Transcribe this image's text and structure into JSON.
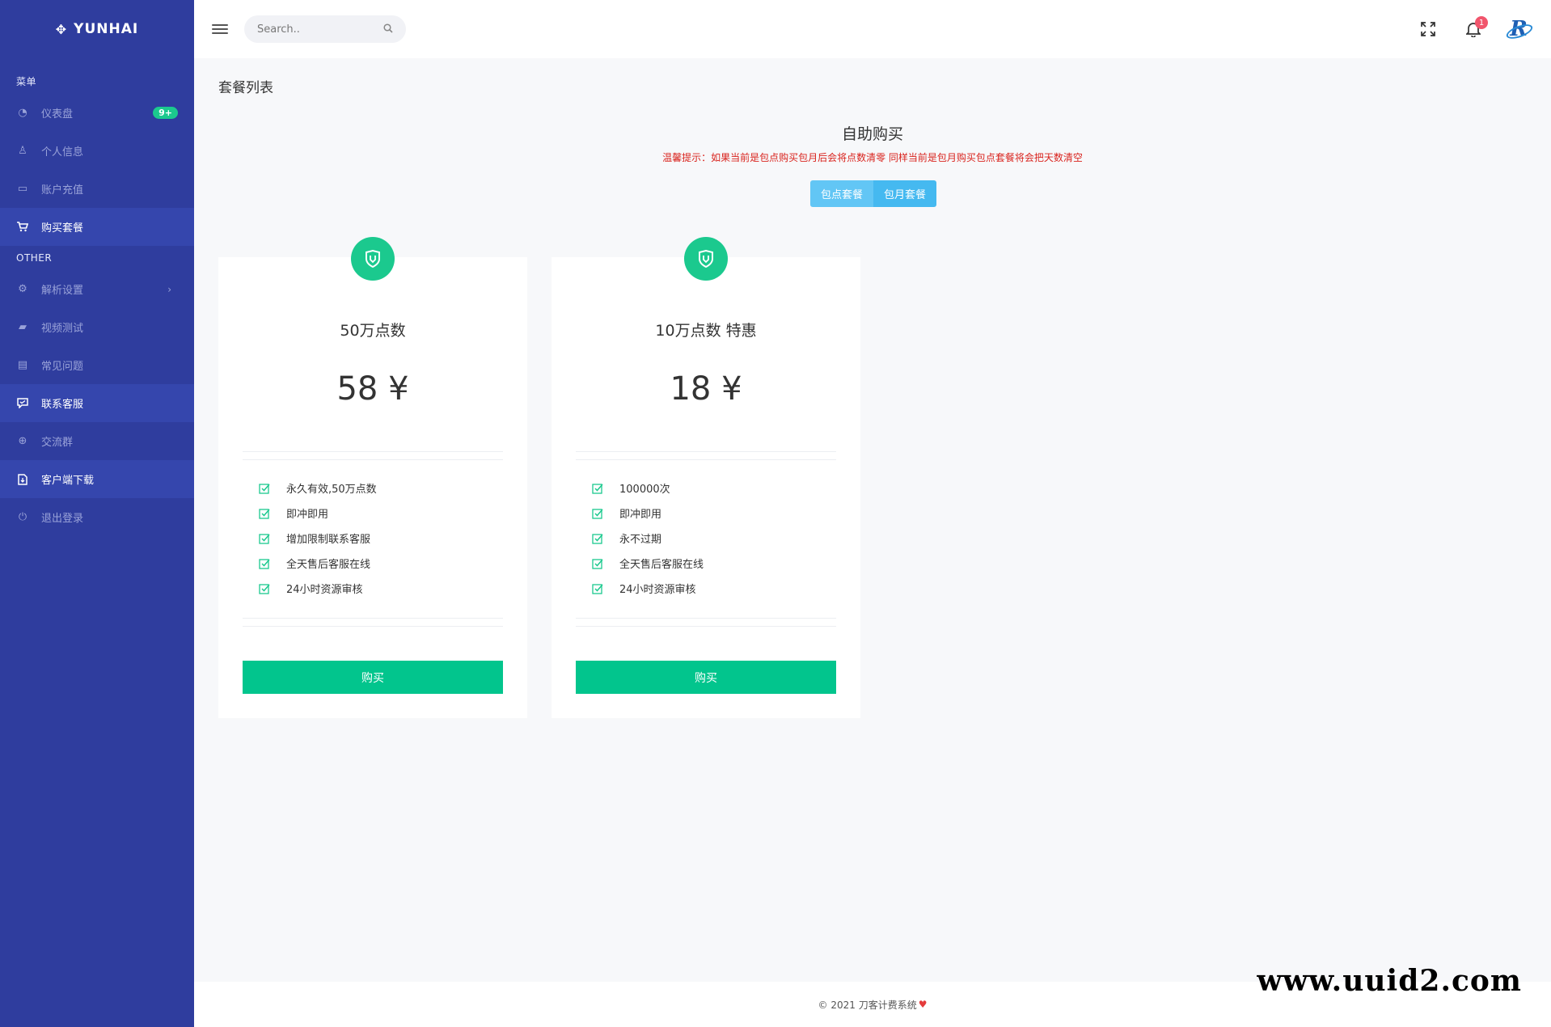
{
  "brand": {
    "name": "YUNHAI"
  },
  "sidebar": {
    "section_menu": "菜单",
    "section_other": "OTHER",
    "items": [
      {
        "label": "仪表盘",
        "icon": "dashboard-icon",
        "badge": "9+"
      },
      {
        "label": "个人信息",
        "icon": "user-icon"
      },
      {
        "label": "账户充值",
        "icon": "card-icon"
      },
      {
        "label": "购买套餐",
        "icon": "cart-icon",
        "active": true
      },
      {
        "label": "解析设置",
        "icon": "gear-icon",
        "has_submenu": true
      },
      {
        "label": "视频测试",
        "icon": "video-icon"
      },
      {
        "label": "常见问题",
        "icon": "document-icon"
      },
      {
        "label": "联系客服",
        "icon": "chat-icon",
        "active": true
      },
      {
        "label": "交流群",
        "icon": "group-icon"
      },
      {
        "label": "客户端下载",
        "icon": "download-icon",
        "active": true
      },
      {
        "label": "退出登录",
        "icon": "power-icon"
      }
    ]
  },
  "topbar": {
    "search_placeholder": "Search..",
    "notification_count": "1"
  },
  "page": {
    "title": "套餐列表",
    "hero_title": "自助购买",
    "tip": "温馨提示：如果当前是包点购买包月后会将点数清零 同样当前是包月购买包点套餐将会把天数清空",
    "toggle": [
      "包点套餐",
      "包月套餐"
    ]
  },
  "plans": [
    {
      "name": "50万点数",
      "price": "58 ¥",
      "features": [
        "永久有效,50万点数",
        "即冲即用",
        "增加限制联系客服",
        "全天售后客服在线",
        "24小时资源审核"
      ],
      "buy_label": "购买"
    },
    {
      "name": "10万点数 特惠",
      "price": "18 ¥",
      "features": [
        "100000次",
        "即冲即用",
        "永不过期",
        "全天售后客服在线",
        "24小时资源审核"
      ],
      "buy_label": "购买"
    }
  ],
  "footer": {
    "text": "© 2021 刀客计费系统"
  },
  "watermark": "www.uuid2.com",
  "colors": {
    "sidebar": "#2f3d9e",
    "accent_green": "#02c58d",
    "toggle_blue": "#62c6f5",
    "tip_red": "#d9231d"
  }
}
